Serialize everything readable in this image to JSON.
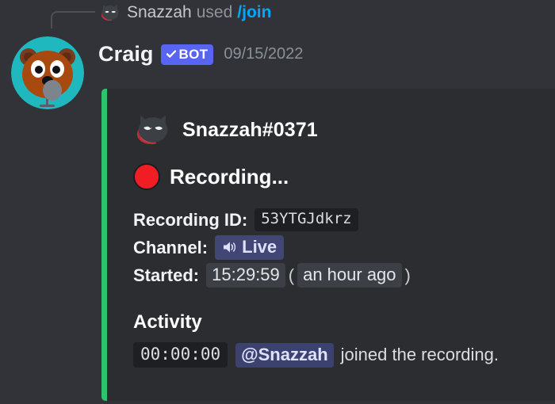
{
  "colors": {
    "page_bg": "#313338",
    "embed_bg": "#2B2D31",
    "embed_accent": "#2FC16B",
    "bot_badge": "#5865F2",
    "link": "#00A8FC",
    "mention_bg": "#3C4270",
    "recording_dot": "#F01E24"
  },
  "reply": {
    "icon": "cat-avatar-icon",
    "user": "Snazzah",
    "verb": "used",
    "command": "/join"
  },
  "message": {
    "avatar_icon": "craig-beaver-avatar",
    "author": "Craig",
    "bot_badge": {
      "check_icon": "check-icon",
      "label": "BOT"
    },
    "timestamp": "09/15/2022"
  },
  "embed": {
    "author": {
      "icon": "cat-avatar-icon",
      "name": "Snazzah#0371"
    },
    "title": {
      "icon": "red-circle-icon",
      "text": "Recording..."
    },
    "fields": [
      {
        "label": "Recording ID:",
        "value": "53YTGJdkrz",
        "style": "code"
      },
      {
        "label": "Channel:",
        "value": "Live",
        "icon": "speaker-icon",
        "style": "channel-mention"
      },
      {
        "label": "Started:",
        "value": "15:29:59",
        "relative": "an hour ago",
        "paren_open": "(",
        "paren_close": ")",
        "style": "timestamp"
      }
    ],
    "activity": {
      "heading": "Activity",
      "entries": [
        {
          "time": "00:00:00",
          "mention": "@Snazzah",
          "text": "joined the recording."
        }
      ]
    }
  }
}
